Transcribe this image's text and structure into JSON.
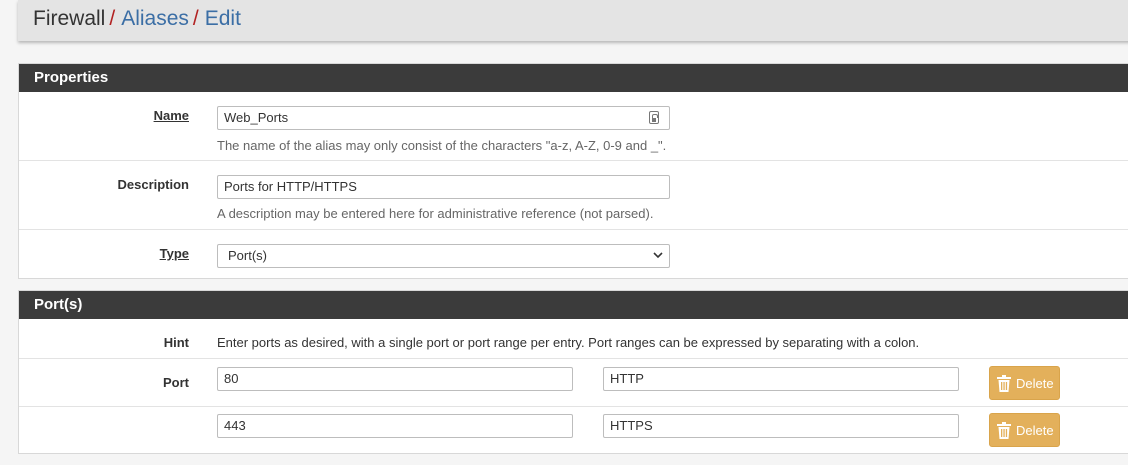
{
  "breadcrumb": {
    "items": [
      "Firewall",
      "Aliases",
      "Edit"
    ],
    "separator": "/"
  },
  "properties": {
    "heading": "Properties",
    "name": {
      "label": "Name",
      "value": "Web_Ports",
      "help": "The name of the alias may only consist of the characters \"a-z, A-Z, 0-9 and _\"."
    },
    "description": {
      "label": "Description",
      "value": "Ports for HTTP/HTTPS",
      "help": "A description may be entered here for administrative reference (not parsed)."
    },
    "type": {
      "label": "Type",
      "value": "Port(s)"
    }
  },
  "ports": {
    "heading": "Port(s)",
    "hint_label": "Hint",
    "hint_text": "Enter ports as desired, with a single port or port range per entry. Port ranges can be expressed by separating with a colon.",
    "port_label": "Port",
    "entries": [
      {
        "port": "80",
        "description": "HTTP",
        "delete_label": "Delete"
      },
      {
        "port": "443",
        "description": "HTTPS",
        "delete_label": "Delete"
      }
    ]
  },
  "colors": {
    "accent_link": "#3b6ea5",
    "separator": "#b22222",
    "panel_heading": "#3b3b3b",
    "delete_button": "#e3b05b"
  }
}
